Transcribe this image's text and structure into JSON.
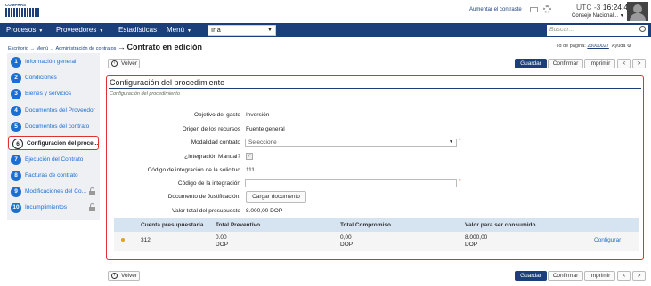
{
  "header": {
    "logo_text": "COMPRAS DOMINICANA",
    "contrast_link": "Aumentar el contraste",
    "utc_label": "UTC -3",
    "time": "16:24:46",
    "org": "Consejo Nacional..."
  },
  "nav": {
    "items": [
      "Procesos",
      "Proveedores",
      "Estadísticas",
      "Menú"
    ],
    "goto_value": "Ir a",
    "search_placeholder": "Buscar..."
  },
  "breadcrumb": {
    "items": [
      "Escritorio",
      "Menú",
      "Administración de contratos"
    ],
    "separator": "→",
    "current": "Contrato en edición",
    "page_id_label": "Id de página:",
    "page_id_value": "23000027",
    "help": "Ayuda"
  },
  "sidebar": {
    "items": [
      {
        "num": "1",
        "label": "Información general",
        "locked": false
      },
      {
        "num": "2",
        "label": "Condiciones",
        "locked": false
      },
      {
        "num": "3",
        "label": "Bienes y servicios",
        "locked": false
      },
      {
        "num": "4",
        "label": "Documentos del Proveedor",
        "locked": false
      },
      {
        "num": "5",
        "label": "Documentos del contrato",
        "locked": false
      },
      {
        "num": "6",
        "label": "Configuración del proce...",
        "locked": false,
        "active": true
      },
      {
        "num": "7",
        "label": "Ejecución del Contrato",
        "locked": false
      },
      {
        "num": "8",
        "label": "Facturas de contrato",
        "locked": false
      },
      {
        "num": "9",
        "label": "Modificaciones del Co...",
        "locked": true
      },
      {
        "num": "10",
        "label": "Incumplimientos",
        "locked": true
      }
    ]
  },
  "toolbar": {
    "back": "Volver",
    "save": "Guardar",
    "confirm": "Confirmar",
    "print": "Imprimir",
    "prev": "<",
    "next": ">"
  },
  "panel": {
    "title": "Configuración del procedimiento",
    "subtitle": "Configuración del procedimiento",
    "fields": {
      "objective_label": "Objetivo del gasto",
      "objective_value": "Inversión",
      "origin_label": "Origen de los recursos",
      "origin_value": "Fuente general",
      "modality_label": "Modalidad contrato",
      "modality_value": "Seleccione",
      "manual_label": "¿Integración Manual?",
      "code_req_label": "Código de integración de la solicitud",
      "code_req_value": "111",
      "code_int_label": "Código de la integración",
      "doc_label": "Documento de Justificación:",
      "doc_button": "Cargar documento",
      "budget_label": "Valor total del presupuesto",
      "budget_value": "8.000,00 DOP"
    },
    "table": {
      "headers": [
        "Cuenta presupuestaria",
        "Total Preventivo",
        "Total Compromiso",
        "Valor para ser consumido"
      ],
      "rows": [
        {
          "account": "312",
          "preventive": "0.00",
          "preventive_cur": "DOP",
          "commitment": "0,00",
          "commitment_cur": "DOP",
          "consumed": "8.000,00",
          "consumed_cur": "DOP",
          "action": "Configurar"
        }
      ]
    }
  }
}
